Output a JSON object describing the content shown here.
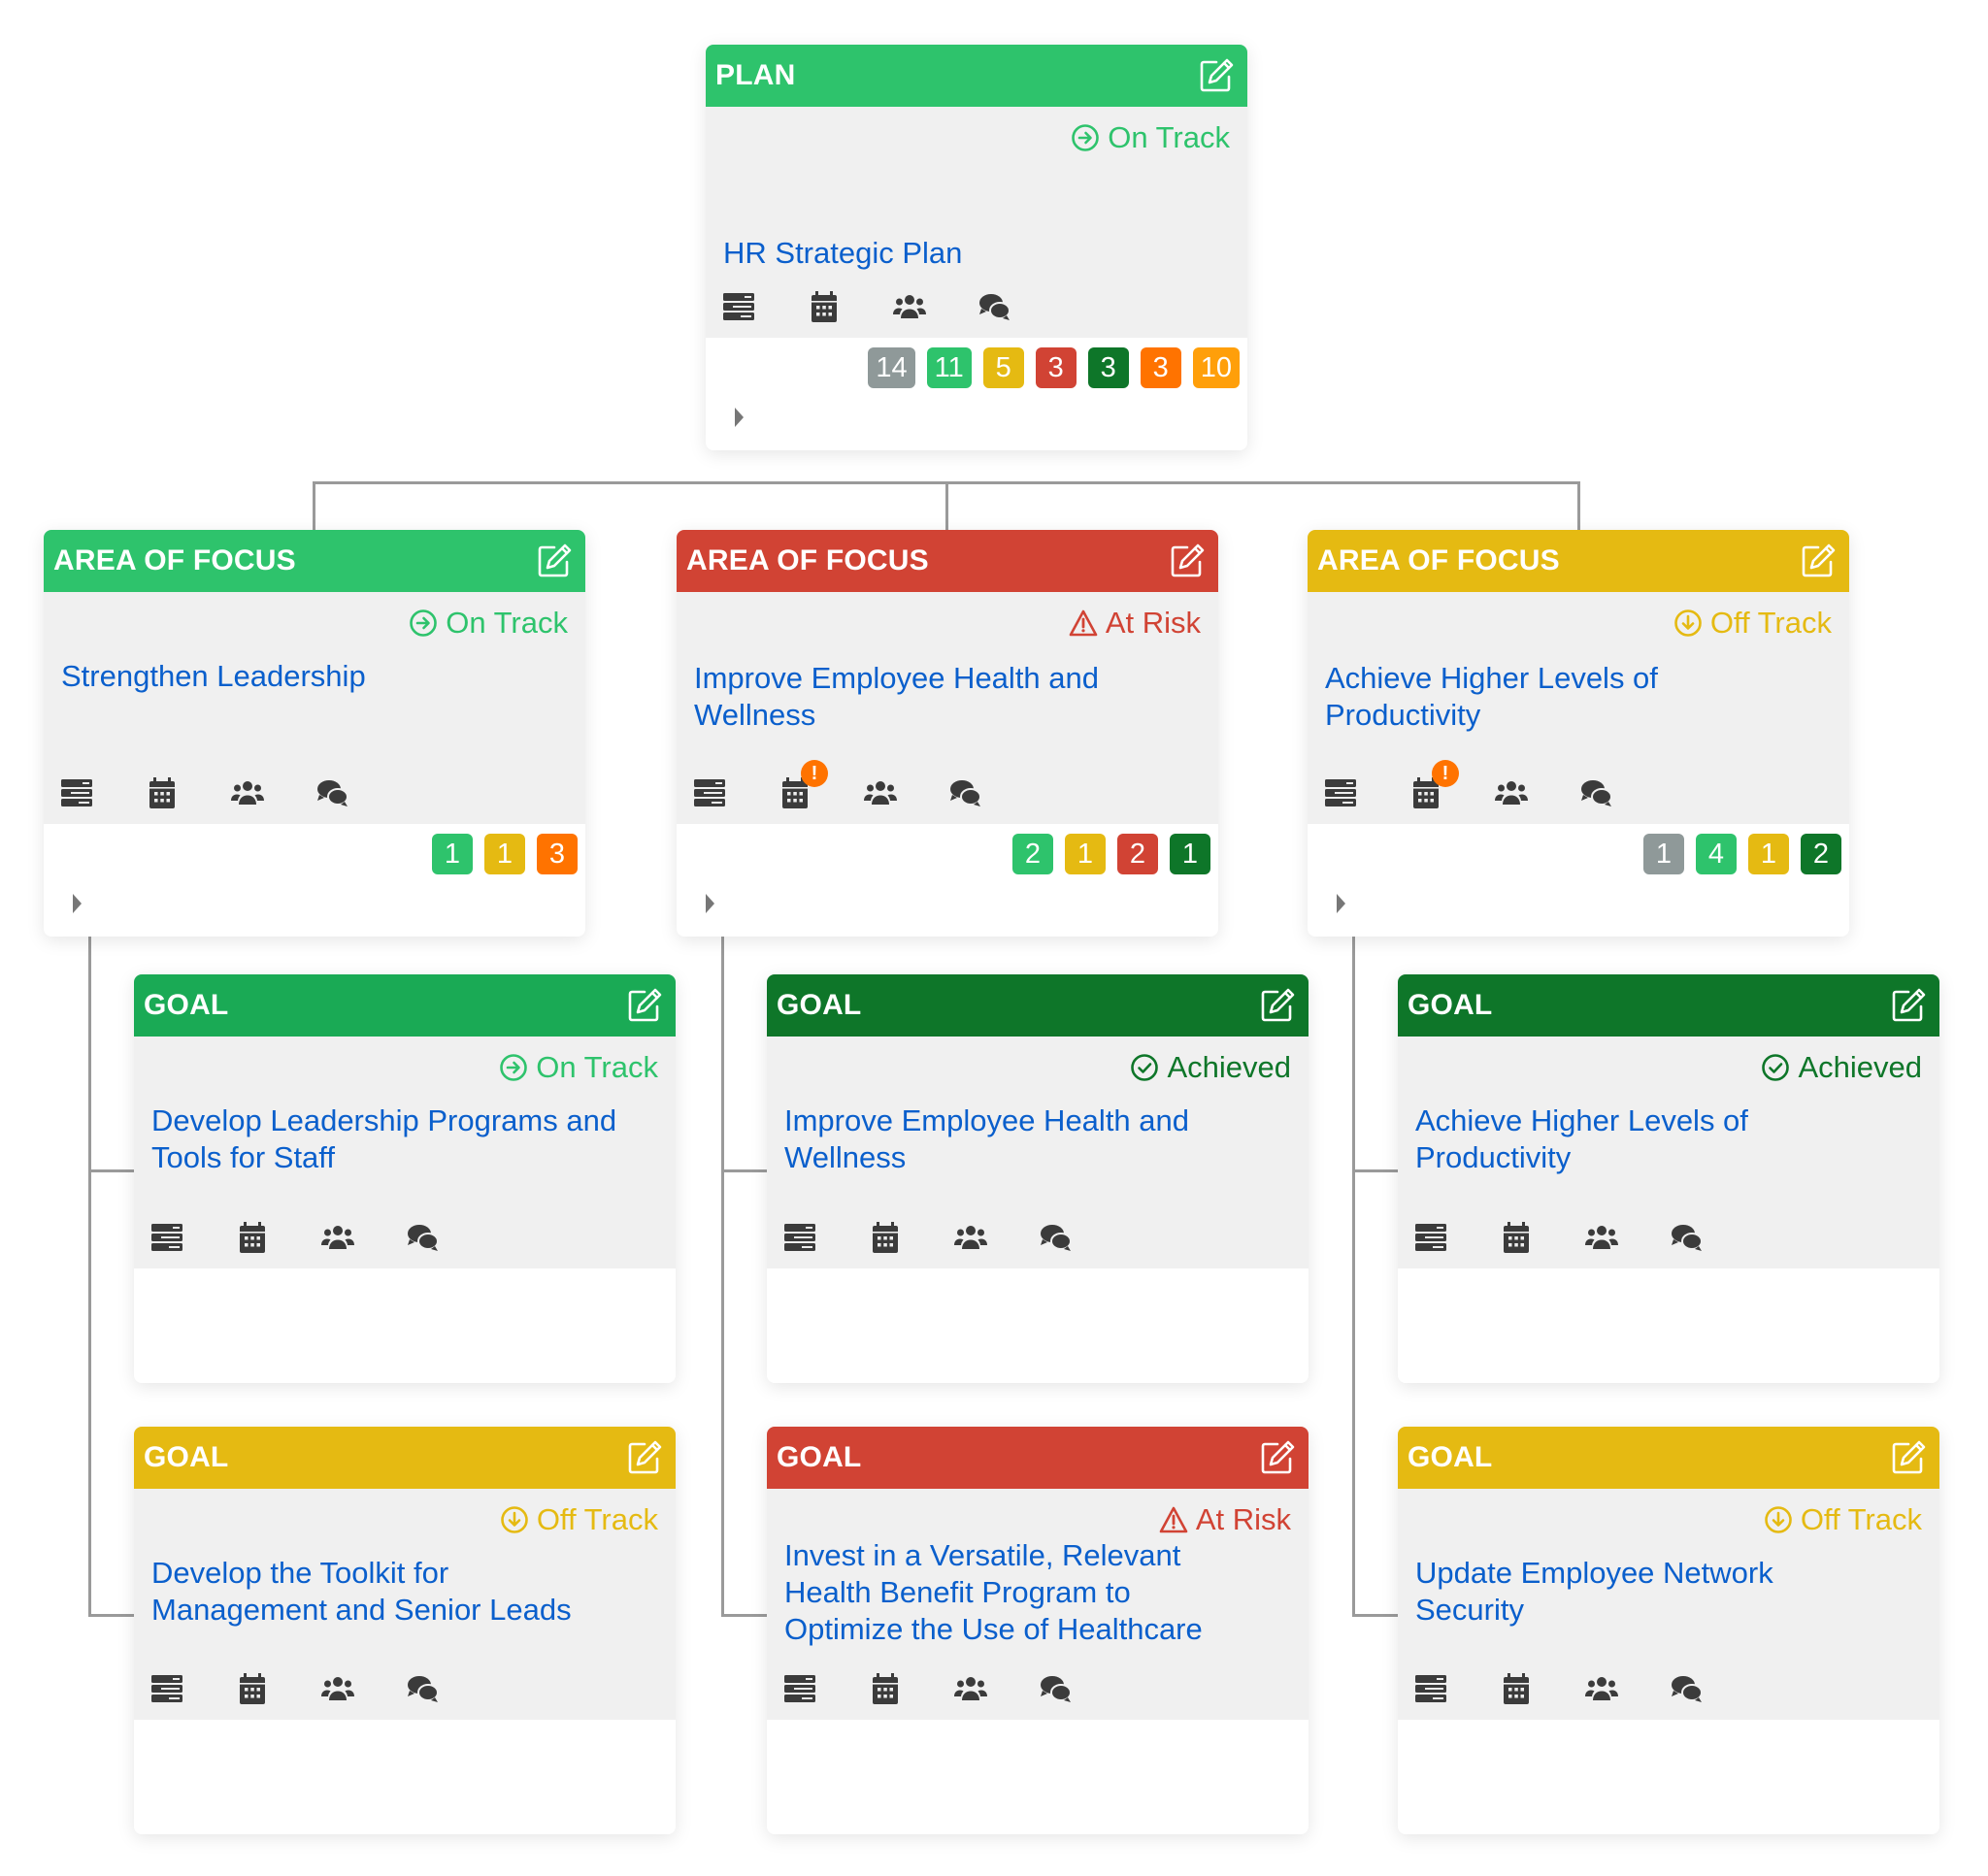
{
  "colors": {
    "on_track": "#2ec36c",
    "goal_on_track": "#1aaa55",
    "at_risk": "#d14334",
    "off_track": "#e5ba12",
    "achieved": "#0e7629",
    "not_started": "#8f9999",
    "orange": "#ff7300",
    "amber": "#ff9f0a",
    "title_blue": "#0a5fcc",
    "icon_dark": "#3b3b3b"
  },
  "icons": [
    "list-icon",
    "calendar-icon",
    "users-icon",
    "comments-icon"
  ],
  "plan": {
    "type_label": "PLAN",
    "status": "On Track",
    "title": "HR Strategic Plan",
    "badges": [
      "14",
      "11",
      "5",
      "3",
      "3",
      "3",
      "10"
    ]
  },
  "areas": [
    {
      "type_label": "AREA OF FOCUS",
      "status": "On Track",
      "title": "Strengthen Leadership",
      "badges": [
        "1",
        "1",
        "3"
      ],
      "calendar_alert": "",
      "goals": [
        {
          "type_label": "GOAL",
          "status": "On Track",
          "title": "Develop Leadership Programs and Tools for Staff"
        },
        {
          "type_label": "GOAL",
          "status": "Off Track",
          "title": "Develop the Toolkit for Management and Senior Leads"
        }
      ]
    },
    {
      "type_label": "AREA OF FOCUS",
      "status": "At Risk",
      "title": "Improve Employee Health and Wellness",
      "badges": [
        "2",
        "1",
        "2",
        "1"
      ],
      "calendar_alert": "!",
      "goals": [
        {
          "type_label": "GOAL",
          "status": "Achieved",
          "title": "Improve Employee Health and Wellness"
        },
        {
          "type_label": "GOAL",
          "status": "At Risk",
          "title": "Invest in a Versatile, Relevant Health Benefit Program to Optimize the Use of Healthcare"
        }
      ]
    },
    {
      "type_label": "AREA OF FOCUS",
      "status": "Off Track",
      "title": "Achieve Higher Levels of Productivity",
      "badges": [
        "1",
        "4",
        "1",
        "2"
      ],
      "calendar_alert": "!",
      "goals": [
        {
          "type_label": "GOAL",
          "status": "Achieved",
          "title": "Achieve Higher Levels of Productivity"
        },
        {
          "type_label": "GOAL",
          "status": "Off Track",
          "title": "Update Employee Network Security"
        }
      ]
    }
  ]
}
